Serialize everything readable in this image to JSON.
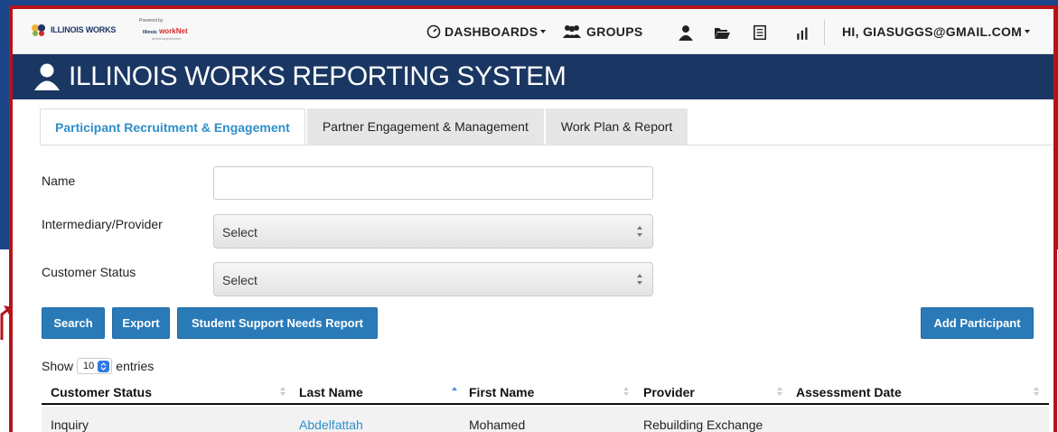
{
  "topnav": {
    "logo_text": "ILLINOIS WORKS",
    "logo2_powered": "Powered by",
    "logo2_brand_a": "Illinois",
    "logo2_brand_b": "workNet",
    "logo2_sub": "americanjobcenter",
    "dashboards_label": "DASHBOARDS",
    "groups_label": "GROUPS",
    "user_label": "HI, GIASUGGS@GMAIL.COM"
  },
  "header": {
    "title": "ILLINOIS WORKS REPORTING SYSTEM"
  },
  "tabs": [
    {
      "label": "Participant Recruitment & Engagement",
      "active": true
    },
    {
      "label": "Partner Engagement & Management",
      "active": false
    },
    {
      "label": "Work Plan & Report",
      "active": false
    }
  ],
  "form": {
    "name_label": "Name",
    "name_value": "",
    "intermediary_label": "Intermediary/Provider",
    "intermediary_value": "Select",
    "status_label": "Customer Status",
    "status_value": "Select"
  },
  "actions": {
    "search": "Search",
    "export": "Export",
    "report": "Student Support Needs Report",
    "add": "Add Participant"
  },
  "entries": {
    "show": "Show",
    "count": "10",
    "suffix": "entries"
  },
  "table": {
    "columns": [
      "Customer Status",
      "Last Name",
      "First Name",
      "Provider",
      "Assessment Date"
    ],
    "rows": [
      [
        "Inquiry",
        "Abdelfattah",
        "Mohamed",
        "Rebuilding Exchange",
        ""
      ]
    ]
  },
  "colors": {
    "navy": "#1a3763",
    "accent_blue": "#2a7ab8",
    "frame_red": "#b5141c",
    "tab_active_text": "#2f8fc9"
  }
}
